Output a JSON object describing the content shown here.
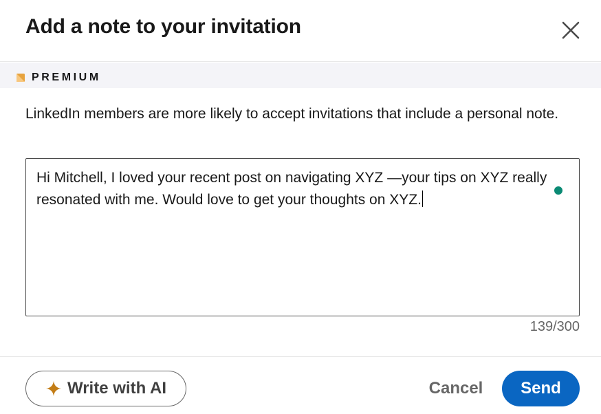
{
  "dialog": {
    "title": "Add a note to your invitation",
    "close_icon": "close-icon"
  },
  "premium": {
    "label": "PREMIUM",
    "icon": "premium-badge-icon",
    "icon_color": "#e7a33e"
  },
  "description": "LinkedIn members are more likely to accept invitations that include a personal note.",
  "note": {
    "value": "Hi Mitchell, I loved your recent post on navigating XYZ —your tips on XYZ really resonated with me. Would love to get your thoughts on XYZ.",
    "char_count": "139/300"
  },
  "footer": {
    "ai_button_label": "Write with AI",
    "ai_icon": "sparkle-icon",
    "ai_icon_color": "#c37d16",
    "cancel_label": "Cancel",
    "send_label": "Send"
  },
  "colors": {
    "send_button": "#0a66c2",
    "grammar_indicator": "#0a8a74"
  }
}
